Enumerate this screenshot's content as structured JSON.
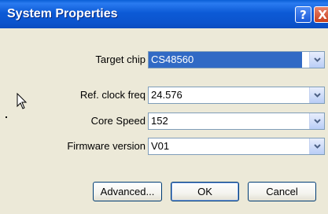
{
  "window": {
    "title": "System Properties",
    "help_label": "?",
    "close_label": "X"
  },
  "fields": [
    {
      "label": "Target chip",
      "value": "CS48560",
      "selected": true
    },
    {
      "label": "Ref. clock freq",
      "value": "24.576",
      "selected": false
    },
    {
      "label": "Core Speed",
      "value": "152",
      "selected": false
    },
    {
      "label": "Firmware version",
      "value": "V01",
      "selected": false
    }
  ],
  "buttons": {
    "advanced": "Advanced...",
    "ok": "OK",
    "cancel": "Cancel"
  },
  "colors": {
    "titlebar": "#0b54cd",
    "selection": "#316ac5",
    "dialog_bg": "#ece9d8"
  }
}
